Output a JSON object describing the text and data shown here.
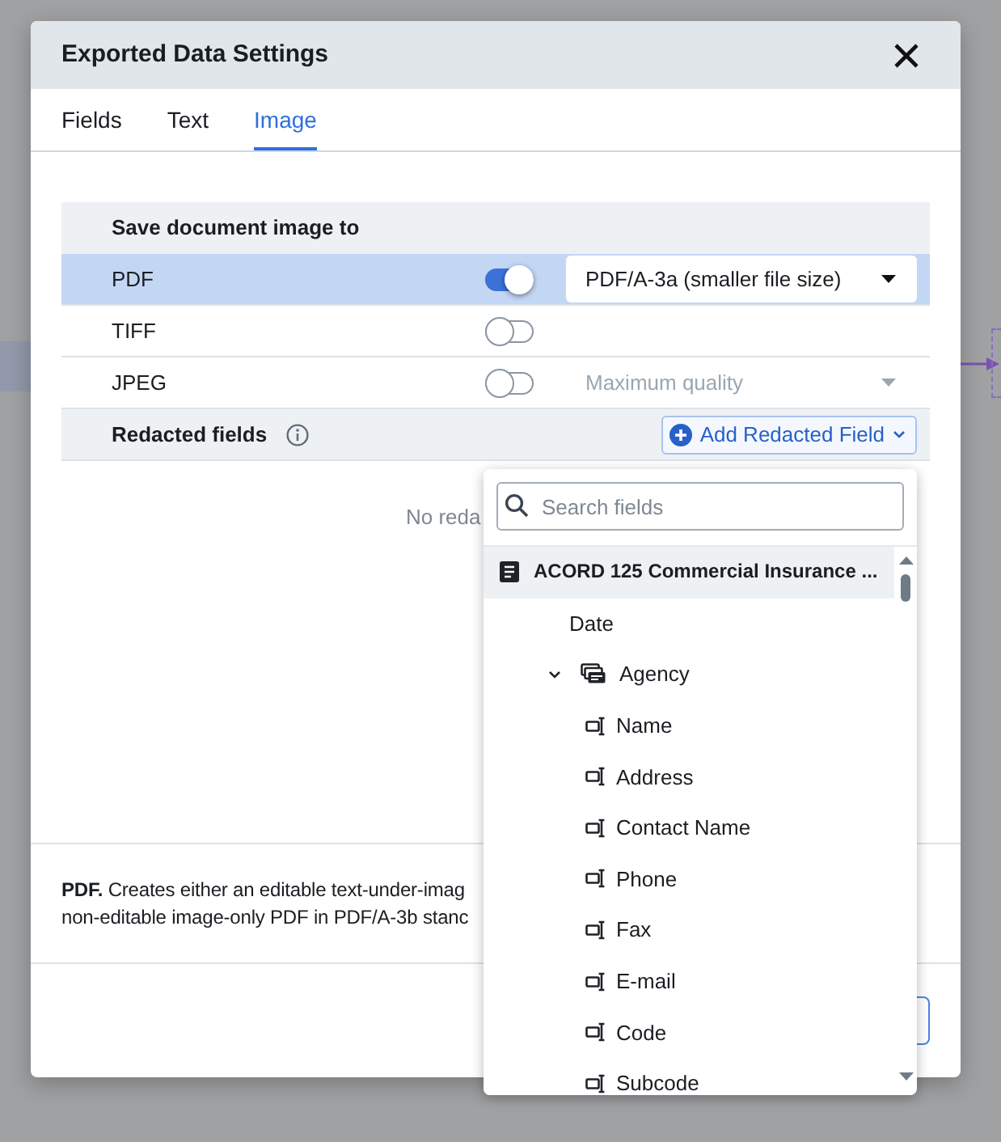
{
  "dialog": {
    "title": "Exported Data Settings"
  },
  "tabs": [
    {
      "label": "Fields",
      "selected": false
    },
    {
      "label": "Text",
      "selected": false
    },
    {
      "label": "Image",
      "selected": true
    }
  ],
  "save_section": {
    "heading": "Save document image to",
    "formats": [
      {
        "name": "PDF",
        "selected": true,
        "on": true,
        "option": {
          "value": "PDF/A-3a (smaller file size)",
          "disabled": false
        }
      },
      {
        "name": "TIFF",
        "selected": false,
        "on": false
      },
      {
        "name": "JPEG",
        "selected": false,
        "on": false,
        "option": {
          "value": "Maximum quality",
          "disabled": true
        }
      }
    ]
  },
  "redacted_section": {
    "heading": "Redacted fields",
    "add_button": "Add Redacted Field",
    "empty_message": "No reda"
  },
  "description": {
    "lines": [
      "**PDF.** Creates either an editable text-under-imag",
      "non-editable image-only PDF in PDF/A-3b stanc"
    ]
  },
  "field_picker": {
    "search": {
      "placeholder": "Search fields"
    },
    "tree": [
      {
        "label": "ACORD 125 Commercial Insurance ...",
        "kind": "document",
        "selected": true,
        "children": [
          {
            "label": "Date",
            "kind": "item",
            "selected": false
          },
          {
            "label": "Agency",
            "kind": "group",
            "selected": false,
            "expanded": true,
            "children": [
              {
                "label": "Name",
                "kind": "field",
                "selected": false
              },
              {
                "label": "Address",
                "kind": "field",
                "selected": false
              },
              {
                "label": "Contact Name",
                "kind": "field",
                "selected": false
              },
              {
                "label": "Phone",
                "kind": "field",
                "selected": false
              },
              {
                "label": "Fax",
                "kind": "field",
                "selected": false
              },
              {
                "label": "E-mail",
                "kind": "field",
                "selected": false
              },
              {
                "label": "Code",
                "kind": "field",
                "selected": false
              },
              {
                "label": "Subcode",
                "kind": "field",
                "selected": false
              }
            ]
          }
        ]
      }
    ]
  }
}
